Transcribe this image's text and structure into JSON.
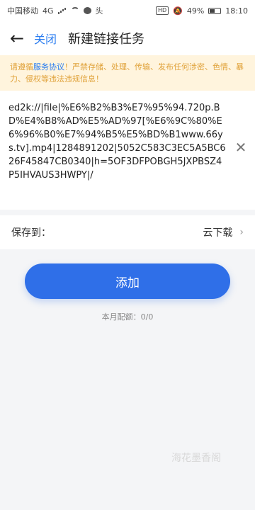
{
  "status_bar": {
    "carrier": "中国移动",
    "network": "4G",
    "battery": "49%",
    "time": "18:10",
    "hd_badge": "HD",
    "app_badge": "头"
  },
  "header": {
    "back_icon": "back-arrow-icon",
    "close_label": "关闭",
    "title": "新建链接任务"
  },
  "notice": {
    "prefix": "请遵循",
    "link": "服务协议",
    "suffix": "！严禁存储、处理、传输、发布任何涉密、色情、暴力、侵权等违法违规信息！"
  },
  "link_input": {
    "value": "ed2k://|file|%E6%B2%B3%E7%95%94.720p.BD%E4%B8%AD%E5%AD%97[%E6%9C%80%E6%96%B0%E7%94%B5%E5%BD%B1www.66ys.tv].mp4|1284891202|5052C583C3EC5A5BC626F45847CB0340|h=5OF3DFPOBGH5JXPBSZ4P5IHVAUS3HWPY|/"
  },
  "save": {
    "label": "保存到：",
    "target": "云下载"
  },
  "add_button": {
    "label": "添加"
  },
  "quota": {
    "text": "本月配额：0/0"
  },
  "watermark": {
    "text": "海花墨香阁"
  },
  "colors": {
    "accent": "#2f6fe8",
    "notice_bg": "#fff4dd",
    "notice_text": "#e0a23a"
  }
}
